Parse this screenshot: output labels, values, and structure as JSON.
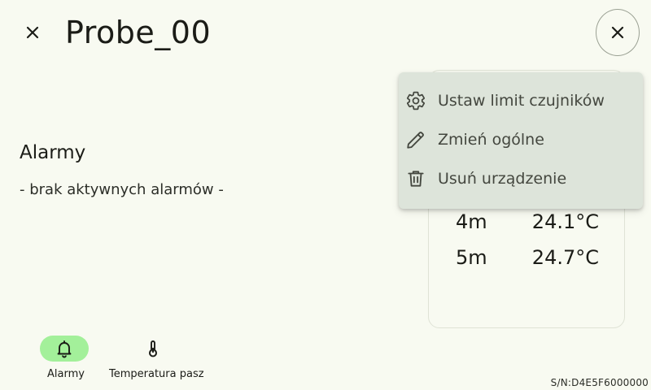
{
  "header": {
    "title": "Probe_00",
    "close_icon": "close-icon",
    "close_circle_icon": "close-icon"
  },
  "alarms": {
    "title": "Alarmy",
    "empty_text": "- brak aktywnych alarmów -"
  },
  "temperatures": [
    {
      "depth": "4m",
      "value": "24.1°C"
    },
    {
      "depth": "5m",
      "value": "24.7°C"
    }
  ],
  "menu": {
    "items": [
      {
        "icon": "gear-icon",
        "label": "Ustaw limit czujników"
      },
      {
        "icon": "pencil-icon",
        "label": "Zmień ogólne"
      },
      {
        "icon": "trash-icon",
        "label": "Usuń urządzenie"
      }
    ]
  },
  "nav": {
    "items": [
      {
        "icon": "bell-icon",
        "label": "Alarmy",
        "active": true
      },
      {
        "icon": "thermometer-icon",
        "label": "Temperatura pasz",
        "active": false
      }
    ]
  },
  "footer": {
    "serial": "S/N:D4E5F6000000"
  },
  "colors": {
    "background": "#f8faf1",
    "menu_background": "#dde4da",
    "active_nav_pill": "#a3f09a",
    "text": "#1b1c17"
  }
}
